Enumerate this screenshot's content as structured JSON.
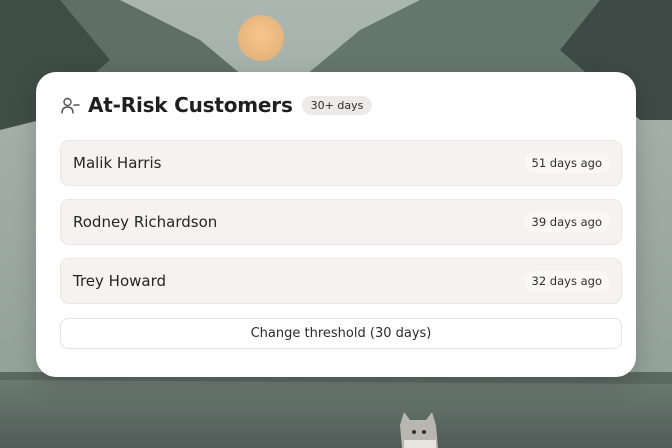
{
  "card": {
    "title": "At-Risk Customers",
    "badge": "30+ days",
    "icon": "user-minus-icon"
  },
  "customers": [
    {
      "name": "Malik Harris",
      "last_seen": "51 days ago"
    },
    {
      "name": "Rodney Richardson",
      "last_seen": "39 days ago"
    },
    {
      "name": "Trey Howard",
      "last_seen": "32 days ago"
    }
  ],
  "actions": {
    "threshold_label": "Change threshold (30 days)"
  }
}
